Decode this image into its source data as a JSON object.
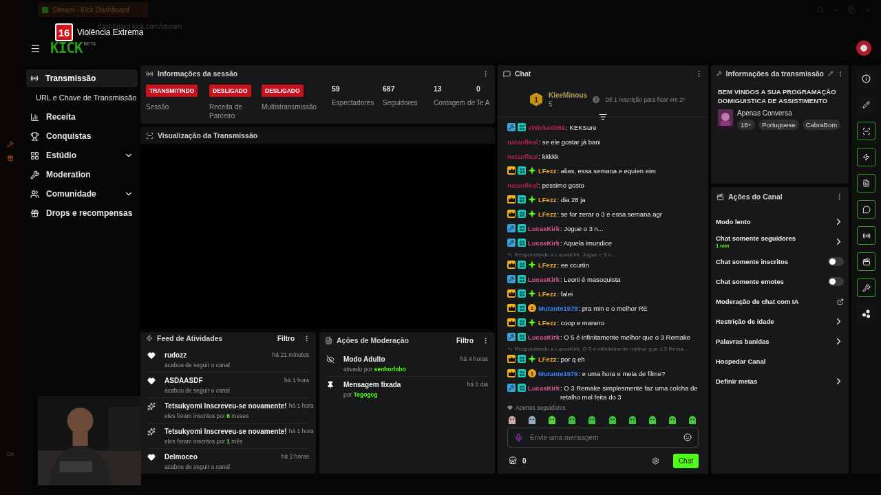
{
  "browser": {
    "tab_title": "Stream - Kick Dashboard",
    "address": "dashboard.kick.com/stream",
    "side_label": "GX"
  },
  "overlay": {
    "rating": "16",
    "rating_text": "Violência Extrema"
  },
  "header": {
    "logo": "KICK",
    "logo_badge": "BETA"
  },
  "sidebar": {
    "items": [
      {
        "label": "Transmissão",
        "kind": "stream",
        "selected": true
      },
      {
        "label": "URL e Chave de Transmissão",
        "kind": "subitem",
        "selected": false
      },
      {
        "label": "Receita",
        "kind": "chart",
        "selected": false
      },
      {
        "label": "Conquistas",
        "kind": "trophy",
        "selected": false
      },
      {
        "label": "Estúdio",
        "kind": "grid",
        "selected": false,
        "expanded": false
      },
      {
        "label": "Moderation",
        "kind": "wrench",
        "selected": false
      },
      {
        "label": "Comunidade",
        "kind": "users",
        "selected": false,
        "expanded": false
      },
      {
        "label": "Drops e recompensas",
        "kind": "gift",
        "selected": false
      }
    ]
  },
  "session": {
    "title": "Informações da sessão",
    "stats": [
      {
        "kind": "status",
        "value": "TRANSMITINDO",
        "label": "Sessão"
      },
      {
        "kind": "status",
        "value": "DESLIGADO",
        "label": "Receita de Parceiro"
      },
      {
        "kind": "status",
        "value": "DESLIGADO",
        "label": "Multistransmissão"
      },
      {
        "kind": "number",
        "value": "59",
        "label": "Espectadores"
      },
      {
        "kind": "number",
        "value": "687",
        "label": "Seguidores"
      },
      {
        "kind": "number",
        "value": "13",
        "label": "Contagem de"
      },
      {
        "kind": "number",
        "value": "0",
        "label": "Te A"
      }
    ]
  },
  "preview": {
    "title": "Visualização da Transmissão"
  },
  "activity": {
    "title": "Feed de Atividades",
    "filter": "Filtro",
    "items": [
      {
        "kind": "follow",
        "title": "rudozz",
        "time": "há 21 minutos",
        "detail": "acabou de seguir o canal"
      },
      {
        "kind": "follow",
        "title": "ASDAASDF",
        "time": "há 1 hora",
        "detail": "acabou de seguir o canal"
      },
      {
        "kind": "sub",
        "title": "Tetsukyomi Inscreveu-se novamente!",
        "time": "há 1 hora",
        "detail": "eles foram inscritos por",
        "count": "6",
        "unit": "meses"
      },
      {
        "kind": "sub",
        "title": "Tetsukyomi Inscreveu-se novamente!",
        "time": "há 1 hora",
        "detail": "eles foram inscritos por",
        "count": "1",
        "unit": "mês"
      },
      {
        "kind": "follow",
        "title": "Delmoceo",
        "time": "há 2 horas",
        "detail": "acabou de seguir o canal"
      }
    ]
  },
  "moderation": {
    "title": "Ações de Moderação",
    "filter": "Filtro",
    "items": [
      {
        "kind": "adult",
        "title": "Modo Adulto",
        "time": "há 4 horas",
        "detail": "ativado por",
        "user": "senhorlobo"
      },
      {
        "kind": "pin",
        "title": "Mensagem fixada",
        "time": "há 1 dia",
        "detail": "por",
        "user": "Tegogcg"
      }
    ]
  },
  "chat": {
    "title": "Chat",
    "leader": {
      "rank": "1",
      "name": "KleeMinous",
      "count": "5",
      "next_rank": "2",
      "hint": "Dê 1 inscrição para ficar em 2º"
    },
    "messages": [
      {
        "kind": "message",
        "badges": [
          {
            "kind": "mod"
          },
          {
            "kind": "og"
          }
        ],
        "user": "xWicked666",
        "color": "#b8214a",
        "text": ": KEKSure"
      },
      {
        "kind": "message",
        "user": "natanfleal",
        "color": "#b8214a",
        "text": ": se ele gostar já bani"
      },
      {
        "kind": "message",
        "user": "natanfleal",
        "color": "#b8214a",
        "text": ": kkkkk"
      },
      {
        "kind": "message",
        "badges": [
          {
            "kind": "crown"
          },
          {
            "kind": "og"
          },
          {
            "kind": "sub"
          }
        ],
        "user": "LFezz",
        "color": "#f0a429",
        "text": ": alias, essa semana e equien eim"
      },
      {
        "kind": "message",
        "user": "natanfleal",
        "color": "#b8214a",
        "text": ": pessimo gosto"
      },
      {
        "kind": "message",
        "badges": [
          {
            "kind": "crown"
          },
          {
            "kind": "og"
          },
          {
            "kind": "sub"
          }
        ],
        "user": "LFezz",
        "color": "#f0a429",
        "text": ": dia 28 ja"
      },
      {
        "kind": "message",
        "badges": [
          {
            "kind": "crown"
          },
          {
            "kind": "og"
          },
          {
            "kind": "sub"
          }
        ],
        "user": "LFezz",
        "color": "#f0a429",
        "text": ": se for zerar o 3 e essa semana agr"
      },
      {
        "kind": "message",
        "badges": [
          {
            "kind": "mod"
          },
          {
            "kind": "og"
          }
        ],
        "user": "LucasKirk",
        "color": "#e0558c",
        "text": ": Jogue o 3 n..."
      },
      {
        "kind": "message",
        "badges": [
          {
            "kind": "mod"
          },
          {
            "kind": "og"
          }
        ],
        "user": "LucasKirk",
        "color": "#e0558c",
        "text": ": Aquela imundice"
      },
      {
        "kind": "reply",
        "text": "Respondendo a LucasKirk: Jogue o 3 n..."
      },
      {
        "kind": "message",
        "badges": [
          {
            "kind": "crown"
          },
          {
            "kind": "og"
          },
          {
            "kind": "sub"
          }
        ],
        "user": "LFezz",
        "color": "#f0a429",
        "text": ": ee ccurtin"
      },
      {
        "kind": "message",
        "badges": [
          {
            "kind": "mod"
          },
          {
            "kind": "og"
          }
        ],
        "user": "LucasKirk",
        "color": "#e0558c",
        "text": ": Leoni é masoquista"
      },
      {
        "kind": "message",
        "badges": [
          {
            "kind": "crown"
          },
          {
            "kind": "og"
          },
          {
            "kind": "sub"
          }
        ],
        "user": "LFezz",
        "color": "#f0a429",
        "text": ": falei"
      },
      {
        "kind": "message",
        "badges": [
          {
            "kind": "crown"
          },
          {
            "kind": "og"
          },
          {
            "kind": "gift",
            "label": "1"
          }
        ],
        "user": "Mutante1979",
        "color": "#3b82f6",
        "text": ": pra min e o melhor RE"
      },
      {
        "kind": "message",
        "badges": [
          {
            "kind": "crown"
          },
          {
            "kind": "og"
          },
          {
            "kind": "sub"
          }
        ],
        "user": "LFezz",
        "color": "#f0a429",
        "text": ": coop e manero"
      },
      {
        "kind": "message",
        "badges": [
          {
            "kind": "mod"
          },
          {
            "kind": "og"
          }
        ],
        "user": "LucasKirk",
        "color": "#e0558c",
        "text": ": O 5 é infinitamente melhor que o 3 Remake"
      },
      {
        "kind": "reply",
        "text": "Respondendo a LucasKirk: O 5 é infinitamente melhor que o 3 Rema..."
      },
      {
        "kind": "message",
        "badges": [
          {
            "kind": "crown"
          },
          {
            "kind": "og"
          },
          {
            "kind": "sub"
          }
        ],
        "user": "LFezz",
        "color": "#f0a429",
        "text": ": por q eh"
      },
      {
        "kind": "message",
        "badges": [
          {
            "kind": "crown"
          },
          {
            "kind": "og"
          },
          {
            "kind": "gift",
            "label": "1"
          }
        ],
        "user": "Mutante1979",
        "color": "#3b82f6",
        "text": ": e uma hora e meia de filme?"
      },
      {
        "kind": "message",
        "badges": [
          {
            "kind": "mod"
          },
          {
            "kind": "og"
          }
        ],
        "user": "LucasKirk",
        "color": "#e0558c",
        "text": ": O 3 Remake simplesmente faz uma colcha de retalho mal feita do 3"
      }
    ],
    "mode": "Apenas seguidores",
    "input": {
      "placeholder": "Envie uma mensagem"
    },
    "points": "0",
    "send": "Chat"
  },
  "broadcast": {
    "title": "Informações da transmissão",
    "stream_title": "BEM VINDOS A SUA PROGRAMAÇÃO DOMIGUISTICA DE ASSISTIMENTO",
    "category": "Apenas Conversa",
    "tags": [
      "18+",
      "Portuguese",
      "CabraBom"
    ]
  },
  "channel_actions": {
    "title": "Ações do Canal",
    "items": [
      {
        "kind": "link",
        "label": "Modo lento"
      },
      {
        "kind": "link",
        "label": "Chat somente seguidores",
        "detail": "1 min"
      },
      {
        "kind": "toggle",
        "label": "Chat somente inscritos",
        "on": false
      },
      {
        "kind": "toggle",
        "label": "Chat somente emotes",
        "on": false
      },
      {
        "kind": "external",
        "label": "Moderação de chat com IA"
      },
      {
        "kind": "link",
        "label": "Restrição de idade"
      },
      {
        "kind": "link",
        "label": "Palavras banidas"
      },
      {
        "kind": "plain",
        "label": "Hospedar Canal"
      },
      {
        "kind": "link",
        "label": "Definir metas"
      }
    ]
  },
  "rail": [
    {
      "kind": "info",
      "on": false
    },
    {
      "kind": "pencil",
      "on": false
    },
    {
      "kind": "scan",
      "on": true
    },
    {
      "kind": "zap",
      "on": true
    },
    {
      "kind": "note",
      "on": true
    },
    {
      "kind": "chat",
      "on": true
    },
    {
      "kind": "radio",
      "on": true
    },
    {
      "kind": "actions",
      "on": true
    },
    {
      "kind": "wrench",
      "on": true
    },
    {
      "kind": "dots",
      "on": false
    }
  ]
}
